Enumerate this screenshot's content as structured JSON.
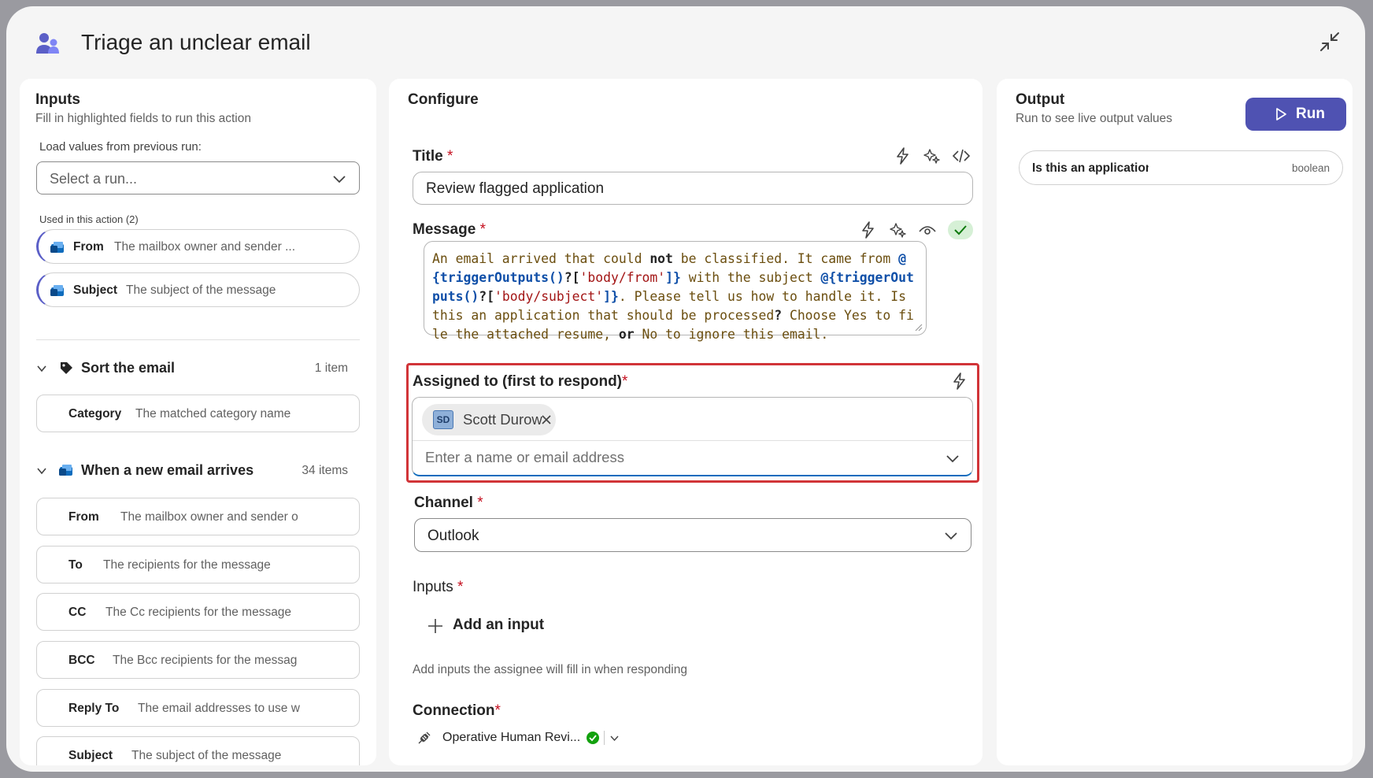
{
  "header": {
    "title": "Triage an unclear email"
  },
  "inputs_panel": {
    "heading": "Inputs",
    "subtitle": "Fill in highlighted fields to run this action",
    "load_label": "Load values from previous run:",
    "run_select_placeholder": "Select a run...",
    "used_label": "Used in this action (2)",
    "used_items": [
      {
        "key": "From",
        "value": "The mailbox owner and sender ..."
      },
      {
        "key": "Subject",
        "value": "The subject of the message"
      }
    ],
    "groups": [
      {
        "name": "Sort the email",
        "count": "1 item",
        "items": [
          {
            "key": "Category",
            "value": "The matched category name"
          }
        ]
      },
      {
        "name": "When a new email arrives",
        "count": "34 items",
        "items": [
          {
            "key": "From",
            "value": "The mailbox owner and sender o"
          },
          {
            "key": "To",
            "value": "The recipients for the message"
          },
          {
            "key": "CC",
            "value": "The Cc recipients for the message"
          },
          {
            "key": "BCC",
            "value": "The Bcc recipients for the messag"
          },
          {
            "key": "Reply To",
            "value": "The email addresses to use w"
          },
          {
            "key": "Subject",
            "value": "The subject of the message"
          }
        ]
      }
    ]
  },
  "configure": {
    "heading": "Configure",
    "title_label": "Title",
    "title_value": "Review flagged application",
    "message_label": "Message",
    "message_segments": {
      "s1": "An email arrived that could ",
      "s2": "not",
      "s3": " be classified. It came from ",
      "s4": "@",
      "s5": "{",
      "s6": "triggerOutputs()",
      "s7": "?[",
      "s8": "'body/from'",
      "s9": "]}",
      "s10": " with the subject ",
      "s11": "@{",
      "s12": "triggerOutputs",
      "s13": "()",
      "s14": "?[",
      "s15": "'body/subject'",
      "s16": "]}",
      "s17": ". Please tell us how to handle it. Is this an application that should be processed",
      "s18": "?",
      "s19": " Choose Yes to file the attached resume, ",
      "s20": "or",
      "s21": " No to ignore this email."
    },
    "assigned_label": "Assigned to (first to respond)",
    "assignee": {
      "initials": "SD",
      "name": "Scott Durow"
    },
    "assigned_placeholder": "Enter a name or email address",
    "channel_label": "Channel",
    "channel_value": "Outlook",
    "inputs_label": "Inputs",
    "add_input_label": "Add an input",
    "inputs_note": "Add inputs the assignee will fill in when responding",
    "connection_label": "Connection",
    "connection_value": "Operative Human Revi..."
  },
  "output": {
    "heading": "Output",
    "subtitle": "Run to see live output values",
    "run_label": "Run",
    "items": [
      {
        "key": "Is this an application",
        "type": "boolean"
      }
    ]
  },
  "colors": {
    "accent": "#4f52b2",
    "required": "#c50f1f",
    "highlight": "#d13438",
    "success": "#13a10e"
  }
}
